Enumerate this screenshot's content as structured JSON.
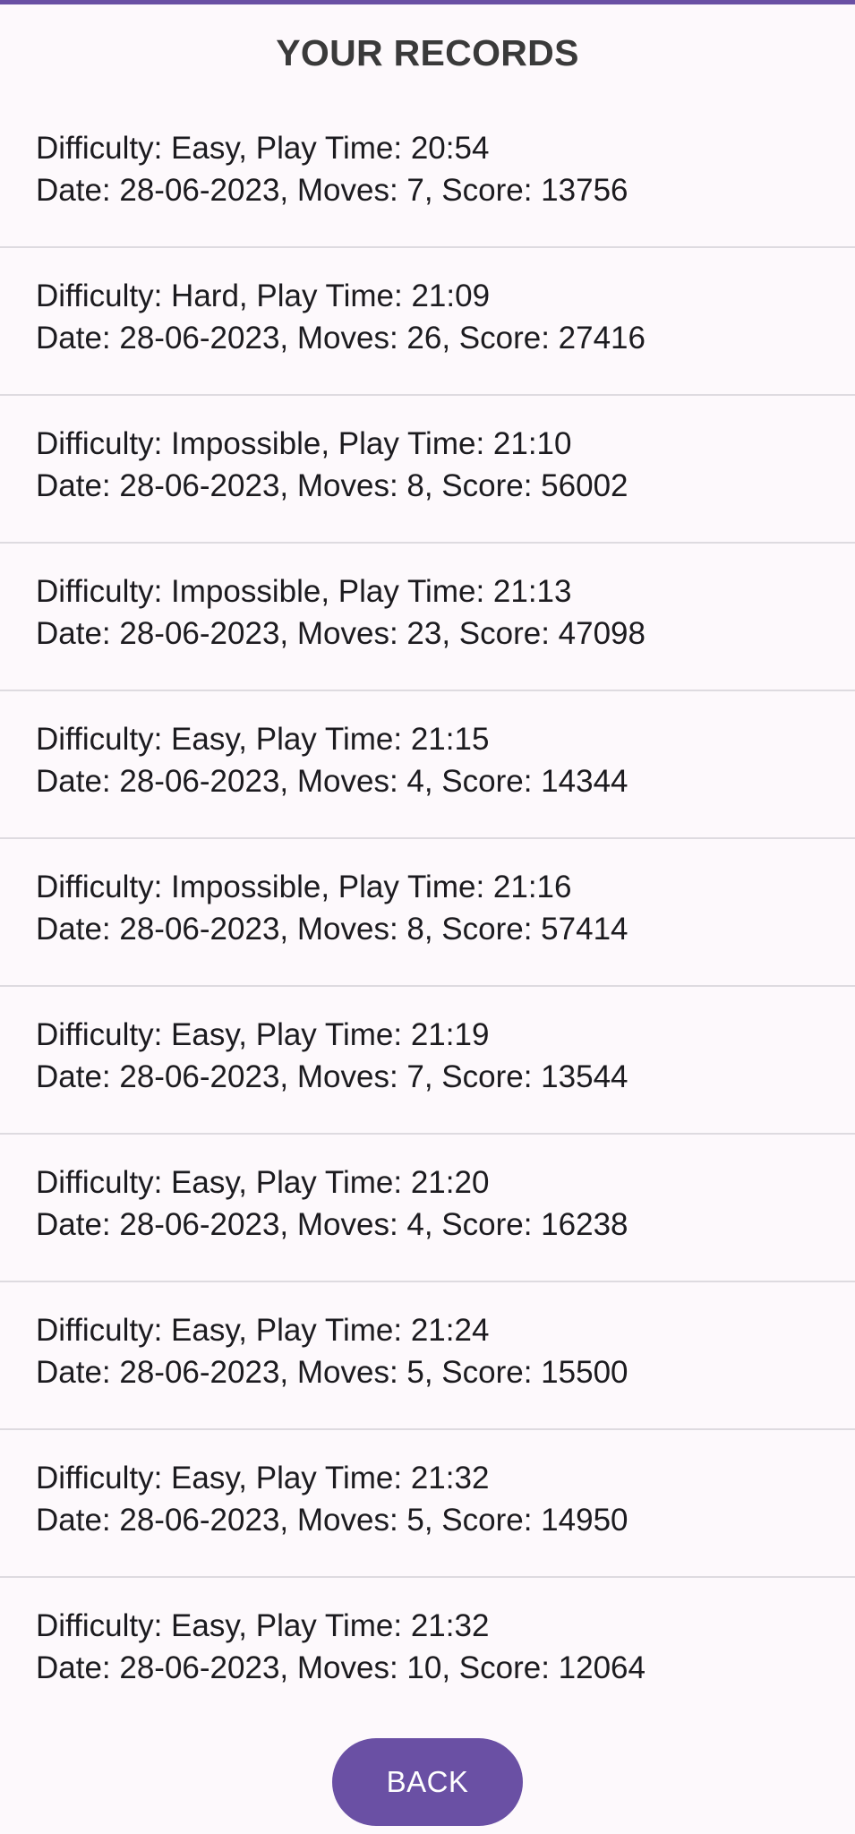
{
  "app": {
    "accent_color": "#6a50a4",
    "background_color": "#fdf9fc"
  },
  "header": {
    "title": "YOUR RECORDS"
  },
  "records": [
    {
      "line1": "Difficulty: Easy, Play Time: 20:54",
      "line2": "Date: 28-06-2023, Moves: 7, Score: 13756"
    },
    {
      "line1": "Difficulty: Hard, Play Time: 21:09",
      "line2": "Date: 28-06-2023, Moves: 26, Score: 27416"
    },
    {
      "line1": "Difficulty: Impossible, Play Time: 21:10",
      "line2": "Date: 28-06-2023, Moves: 8, Score: 56002"
    },
    {
      "line1": "Difficulty: Impossible, Play Time: 21:13",
      "line2": "Date: 28-06-2023, Moves: 23, Score: 47098"
    },
    {
      "line1": "Difficulty: Easy, Play Time: 21:15",
      "line2": "Date: 28-06-2023, Moves: 4, Score: 14344"
    },
    {
      "line1": "Difficulty: Impossible, Play Time: 21:16",
      "line2": "Date: 28-06-2023, Moves: 8, Score: 57414"
    },
    {
      "line1": "Difficulty: Easy, Play Time: 21:19",
      "line2": "Date: 28-06-2023, Moves: 7, Score: 13544"
    },
    {
      "line1": "Difficulty: Easy, Play Time: 21:20",
      "line2": "Date: 28-06-2023, Moves: 4, Score: 16238"
    },
    {
      "line1": "Difficulty: Easy, Play Time: 21:24",
      "line2": "Date: 28-06-2023, Moves: 5, Score: 15500"
    },
    {
      "line1": "Difficulty: Easy, Play Time: 21:32",
      "line2": "Date: 28-06-2023, Moves: 5, Score: 14950"
    },
    {
      "line1": "Difficulty: Easy, Play Time: 21:32",
      "line2": "Date: 28-06-2023, Moves: 10, Score: 12064"
    }
  ],
  "footer": {
    "back_label": "BACK"
  }
}
